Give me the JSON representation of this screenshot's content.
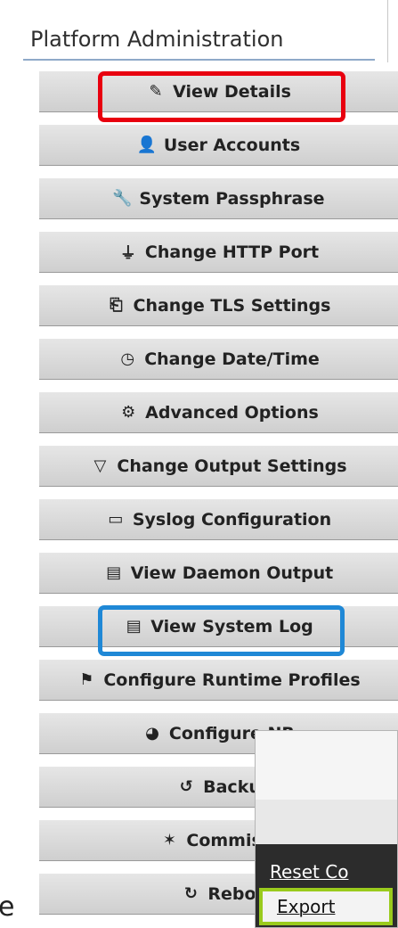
{
  "header": {
    "title": "Platform Administration"
  },
  "menu": {
    "items": [
      {
        "label": "View Details",
        "icon": "pencil-icon",
        "glyph": "✎"
      },
      {
        "label": "User Accounts",
        "icon": "user-icon",
        "glyph": "👤"
      },
      {
        "label": "System Passphrase",
        "icon": "wrench-icon",
        "glyph": "🔧"
      },
      {
        "label": "Change HTTP Port",
        "icon": "plug-icon",
        "glyph": "⏚"
      },
      {
        "label": "Change TLS Settings",
        "icon": "certificate-icon",
        "glyph": "⎗"
      },
      {
        "label": "Change Date/Time",
        "icon": "clock-icon",
        "glyph": "◷"
      },
      {
        "label": "Advanced Options",
        "icon": "gears-icon",
        "glyph": "⚙"
      },
      {
        "label": "Change Output Settings",
        "icon": "filter-icon",
        "glyph": "▽"
      },
      {
        "label": "Syslog Configuration",
        "icon": "log-icon",
        "glyph": "▭"
      },
      {
        "label": "View Daemon Output",
        "icon": "document-icon",
        "glyph": "▤"
      },
      {
        "label": "View System Log",
        "icon": "document-icon",
        "glyph": "▤"
      },
      {
        "label": "Configure Runtime Profiles",
        "icon": "flag-icon",
        "glyph": "⚑"
      },
      {
        "label": "Configure NR",
        "icon": "pie-chart-icon",
        "glyph": "◕"
      },
      {
        "label": "Backu",
        "icon": "history-icon",
        "glyph": "↺"
      },
      {
        "label": "Commissi",
        "icon": "magic-wand-icon",
        "glyph": "✶"
      },
      {
        "label": "Rebo",
        "icon": "refresh-icon",
        "glyph": "↻"
      }
    ]
  },
  "popup": {
    "reset_label": "Reset Co",
    "export_label": "Export"
  },
  "stray_text": "e",
  "colors": {
    "highlight_red": "#e8000f",
    "highlight_blue": "#1f88d6",
    "highlight_green": "#9acb1d"
  }
}
